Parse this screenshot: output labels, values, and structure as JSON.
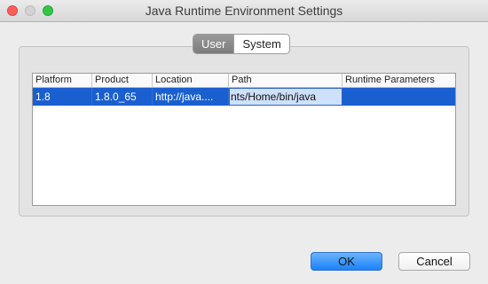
{
  "window": {
    "title": "Java Runtime Environment Settings"
  },
  "tabs": {
    "user": "User",
    "system": "System"
  },
  "table": {
    "columns": [
      "Platform",
      "Product",
      "Location",
      "Path",
      "Runtime Parameters"
    ],
    "row": {
      "platform": "1.8",
      "product": "1.8.0_65",
      "location": "http://java....",
      "path": "nts/Home/bin/java",
      "runtime_parameters": ""
    }
  },
  "buttons": {
    "ok": "OK",
    "cancel": "Cancel"
  }
}
